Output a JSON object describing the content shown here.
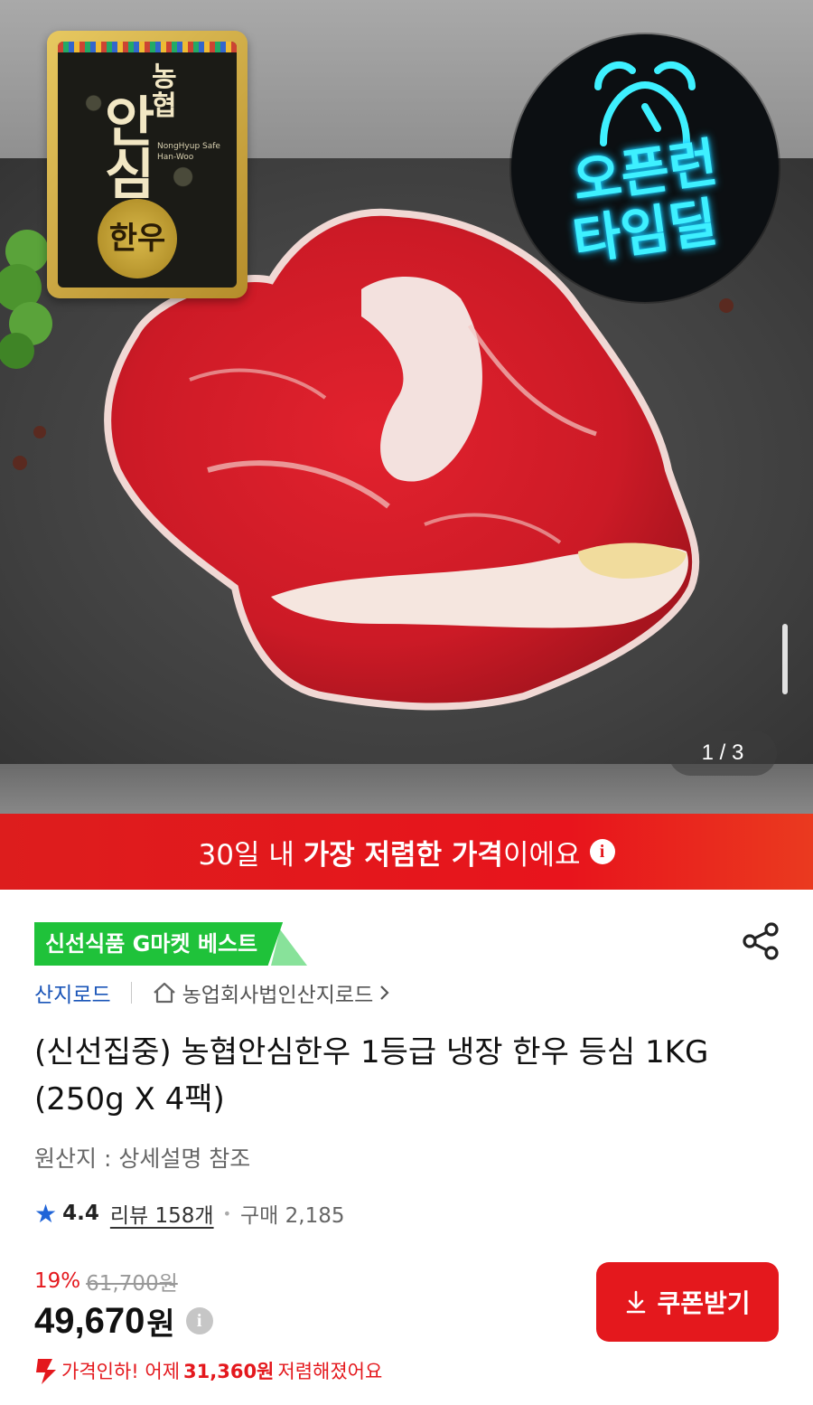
{
  "gallery": {
    "counter": "1 / 3",
    "badge_cert": {
      "line1": "안",
      "line2": "심",
      "side": "농협",
      "english": "NongHyup Safe Han-Woo",
      "circle": "한우"
    },
    "badge_open": {
      "line1": "오픈런",
      "line2": "타임딜"
    }
  },
  "price_banner": {
    "prefix": "30일 내 ",
    "emphasis": "가장 저렴한 가격",
    "suffix": "이에요"
  },
  "product": {
    "best_tag": "신선식품 G마켓 베스트",
    "seller": "산지로드",
    "store_link": "농업회사법인산지로드",
    "title": "(신선집중) 농협안심한우 1등급 냉장 한우 등심 1KG (250g X 4팩)",
    "origin": "원산지 : 상세설명 참조",
    "rating": "4.4",
    "reviews": "리뷰 158개",
    "purchases": "구매 2,185"
  },
  "pricing": {
    "discount_rate": "19%",
    "original_price": "61,700원",
    "price": "49,670",
    "currency": "원",
    "drop_prefix": "가격인하! 어제",
    "drop_amount": "31,360원",
    "drop_suffix": "저렴해졌어요"
  },
  "actions": {
    "coupon_label": "쿠폰받기"
  },
  "colors": {
    "accent_red": "#e4181d",
    "best_green": "#1fc23a",
    "seller_blue": "#1a55b8",
    "neon_cyan": "#3ef0ff"
  }
}
